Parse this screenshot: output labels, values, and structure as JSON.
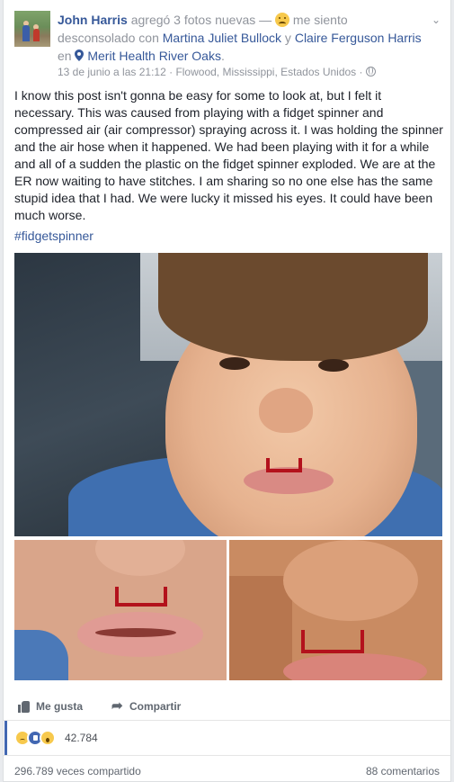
{
  "post": {
    "author": "John Harris",
    "action_text": "agregó 3 fotos nuevas — ",
    "feeling_text": " me siento desconsolado con ",
    "tag1": "Martina Juliet Bullock",
    "conj": " y ",
    "tag2": "Claire Ferguson Harris",
    "loc_prefix": " en ",
    "location": "Merit Health River Oaks",
    "loc_suffix": ".",
    "timestamp": "13 de junio a las 21:12",
    "place": "Flowood, Mississippi, Estados Unidos",
    "sep": " · ",
    "body": "I know this post isn't gonna be easy for some to look at, but I felt it necessary. This was caused from playing with a fidget spinner and compressed air (air compressor) spraying across it. I was holding the spinner and the air hose when it happened. We had been playing with it for a while and all of a sudden the plastic on the fidget spinner exploded. We are at the ER now waiting to have stitches. I am sharing so no one else has the same stupid idea that I had. We were lucky it missed his eyes. It could have been much worse.",
    "hashtag": "#fidgetspinner",
    "feeling_icon": "sad-face-emoji",
    "privacy_icon": "globe-icon"
  },
  "actions": {
    "like_label": "Me gusta",
    "share_label": "Compartir"
  },
  "stats": {
    "reactions_count": "42.784",
    "reaction_types": [
      "sad",
      "like",
      "wow"
    ],
    "shares": "296.789 veces compartido",
    "comments": "88 comentarios"
  },
  "colors": {
    "link": "#365899",
    "meta": "#90949c",
    "accent": "#4267b2"
  }
}
